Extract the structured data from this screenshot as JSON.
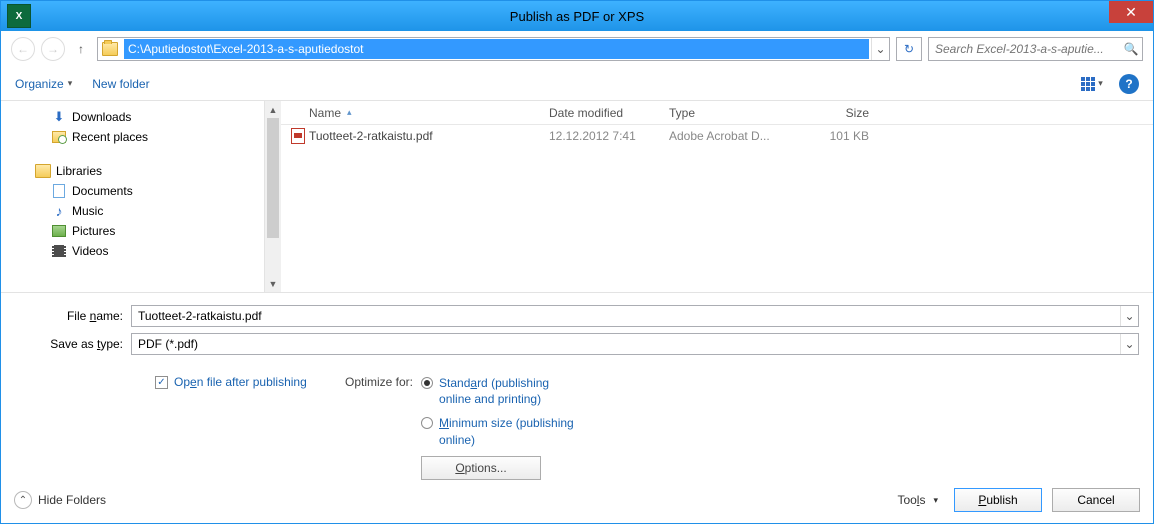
{
  "titlebar": {
    "title": "Publish as PDF or XPS",
    "app_abbrev": "X"
  },
  "navbar": {
    "address": "C:\\Aputiedostot\\Excel-2013-a-s-aputiedostot",
    "search_placeholder": "Search Excel-2013-a-s-aputie..."
  },
  "toolbar": {
    "organize": "Organize",
    "new_folder": "New folder"
  },
  "sidebar": {
    "downloads": "Downloads",
    "recent": "Recent places",
    "libraries": "Libraries",
    "documents": "Documents",
    "music": "Music",
    "pictures": "Pictures",
    "videos": "Videos"
  },
  "columns": {
    "name": "Name",
    "date": "Date modified",
    "type": "Type",
    "size": "Size"
  },
  "files": [
    {
      "name": "Tuotteet-2-ratkaistu.pdf",
      "date": "12.12.2012 7:41",
      "type": "Adobe Acrobat D...",
      "size": "101 KB"
    }
  ],
  "fields": {
    "filename_label_pre": "File ",
    "filename_label_ul": "n",
    "filename_label_post": "ame:",
    "filename_value": "Tuotteet-2-ratkaistu.pdf",
    "savetype_label_pre": "Save as ",
    "savetype_label_ul": "t",
    "savetype_label_post": "ype:",
    "savetype_value": "PDF (*.pdf)"
  },
  "options": {
    "open_after_pre": "Op",
    "open_after_ul": "e",
    "open_after_post": "n file after publishing",
    "optimize_label": "Optimize for:",
    "standard_pre": "Stand",
    "standard_ul": "a",
    "standard_post": "rd (publishing online and printing)",
    "min_ul": "M",
    "min_post": "inimum size (publishing online)",
    "options_btn_ul": "O",
    "options_btn_post": "ptions..."
  },
  "footer": {
    "hide_folders": "Hide Folders",
    "tools_pre": "Too",
    "tools_ul": "l",
    "tools_post": "s",
    "publish_ul": "P",
    "publish_post": "ublish",
    "cancel": "Cancel"
  }
}
